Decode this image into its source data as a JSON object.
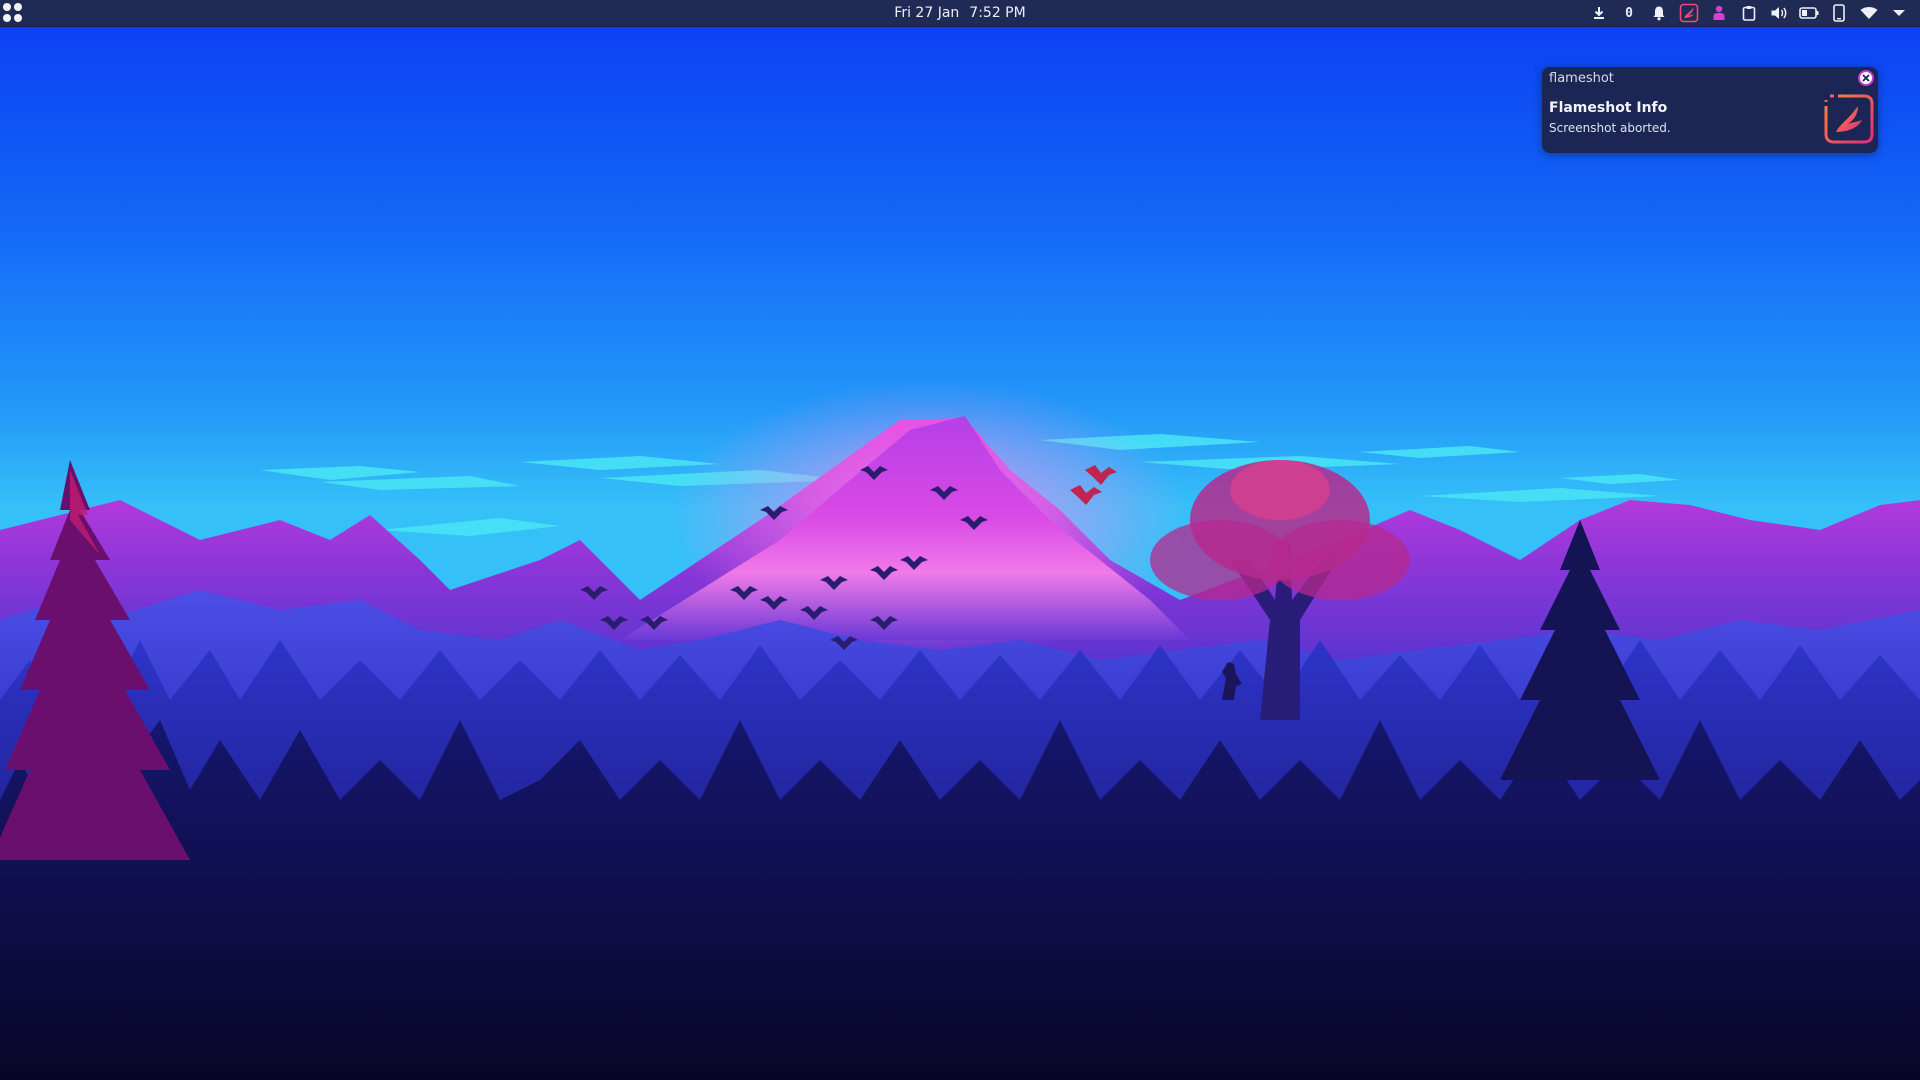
{
  "panel": {
    "date": "Fri 27 Jan",
    "time": "7:52 PM",
    "launcher_icon": "app-grid-icon",
    "tray": [
      {
        "name": "download-icon"
      },
      {
        "name": "counter",
        "value": "0"
      },
      {
        "name": "bell-icon"
      },
      {
        "name": "flameshot-icon"
      },
      {
        "name": "user-icon"
      },
      {
        "name": "clipboard-icon"
      },
      {
        "name": "volume-icon"
      },
      {
        "name": "battery-icon"
      },
      {
        "name": "phone-icon"
      },
      {
        "name": "wifi-icon"
      },
      {
        "name": "chevron-down-icon"
      }
    ]
  },
  "notification": {
    "app_name": "flameshot",
    "title": "Flameshot Info",
    "body": "Screenshot aborted.",
    "icon": "flameshot-logo-icon",
    "close_icon": "close-icon"
  },
  "colors": {
    "panel_bg": "#1f2a55",
    "notification_bg": "#1b2654",
    "accent_pink": "#e3208f",
    "accent_orange": "#f56a2c",
    "accent_purple": "#c837d0"
  },
  "wallpaper": {
    "description_icon": "mountain-landscape-wallpaper"
  }
}
